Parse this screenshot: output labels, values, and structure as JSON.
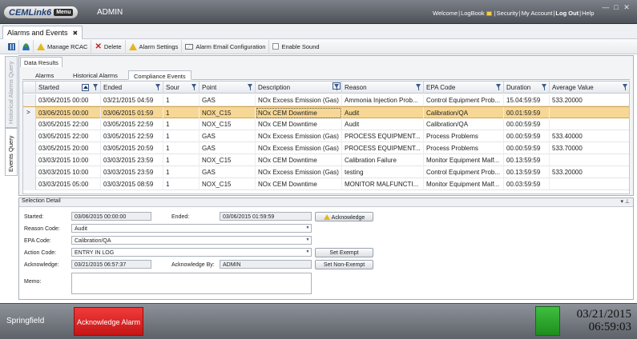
{
  "titlebar": {
    "logo_text": "CEMLink6",
    "menu_label": "Menu",
    "user": "ADMIN",
    "links": [
      "Welcome",
      "LogBook",
      "Security",
      "My Account",
      "Log Out",
      "Help"
    ],
    "window_buttons": [
      "minimize-icon",
      "maximize-icon",
      "close-icon"
    ]
  },
  "doc_tab": {
    "label": "Alarms and Events",
    "close": "✖"
  },
  "toolbar": {
    "manage_rcac": "Manage RCAC",
    "delete": "Delete",
    "alarm_settings": "Alarm Settings",
    "email_config": "Alarm Email Configuration",
    "enable_sound": "Enable Sound"
  },
  "side_tabs": [
    "Historical Alarms Query",
    "Events Query"
  ],
  "main": {
    "subtab": "Data Results",
    "tabs": [
      "Alarms",
      "Historical Alarms",
      "Compliance Events"
    ],
    "active_tab": "Compliance Events"
  },
  "grid": {
    "columns": [
      "Started",
      "Ended",
      "Sour",
      "Point",
      "Description",
      "Reason",
      "EPA Code",
      "Duration",
      "Average Value"
    ],
    "selected_marker": ">",
    "rows": [
      [
        "03/06/2015 00:00",
        "03/21/2015 04:59",
        "1",
        "GAS",
        "NOx Excess Emission (Gas)",
        "Ammonia Injection Prob...",
        "Control Equipment Prob...",
        "15.04:59:59",
        "533.20000"
      ],
      [
        "03/06/2015 00:00",
        "03/06/2015 01:59",
        "1",
        "NOX_C15",
        "NOx CEM Downtime",
        "Audit",
        "Calibration/QA",
        "00.01:59:59",
        ""
      ],
      [
        "03/05/2015 22:00",
        "03/05/2015 22:59",
        "1",
        "NOX_C15",
        "NOx CEM Downtime",
        "Audit",
        "Calibration/QA",
        "00.00:59:59",
        ""
      ],
      [
        "03/05/2015 22:00",
        "03/05/2015 22:59",
        "1",
        "GAS",
        "NOx Excess Emission (Gas)",
        "PROCESS EQUIPMENT...",
        "Process Problems",
        "00.00:59:59",
        "533.40000"
      ],
      [
        "03/05/2015 20:00",
        "03/05/2015 20:59",
        "1",
        "GAS",
        "NOx Excess Emission (Gas)",
        "PROCESS EQUIPMENT...",
        "Process Problems",
        "00.00:59:59",
        "533.70000"
      ],
      [
        "03/03/2015 10:00",
        "03/03/2015 23:59",
        "1",
        "NOX_C15",
        "NOx CEM Downtime",
        "Calibration Failure",
        "Monitor Equipment Malf...",
        "00.13:59:59",
        ""
      ],
      [
        "03/03/2015 10:00",
        "03/03/2015 23:59",
        "1",
        "GAS",
        "NOx Excess Emission (Gas)",
        "testing",
        "Control Equipment Prob...",
        "00.13:59:59",
        "533.20000"
      ],
      [
        "03/03/2015 05:00",
        "03/03/2015 08:59",
        "1",
        "NOX_C15",
        "NOx CEM Downtime",
        "MONITOR MALFUNCTI...",
        "Monitor Equipment Malf...",
        "00.03:59:59",
        ""
      ]
    ]
  },
  "detail": {
    "title": "Selection Detail",
    "pins": "▾ ⊥",
    "started_label": "Started:",
    "started": "03/06/2015 00:00:00",
    "ended_label": "Ended:",
    "ended": "03/06/2015 01:59:59",
    "acknowledge_button": "Acknowledge",
    "reason_label": "Reason Code:",
    "reason": "Audit",
    "epa_label": "EPA Code:",
    "epa": "Calibration/QA",
    "action_label": "Action Code:",
    "action": "ENTRY IN LOG",
    "set_exempt": "Set Exempt",
    "ack_label": "Acknowledge:",
    "ack_time": "03/21/2015 06:57:37",
    "ack_by_label": "Acknowledge By:",
    "ack_by": "ADMIN",
    "set_non_exempt": "Set Non-Exempt",
    "memo_label": "Memo:",
    "memo": ""
  },
  "status": {
    "site": "Springfield",
    "ack_alarm": "Acknowledge Alarm",
    "indicator_color": "#2aa52a",
    "date": "03/21/2015",
    "time": "06:59:03"
  }
}
